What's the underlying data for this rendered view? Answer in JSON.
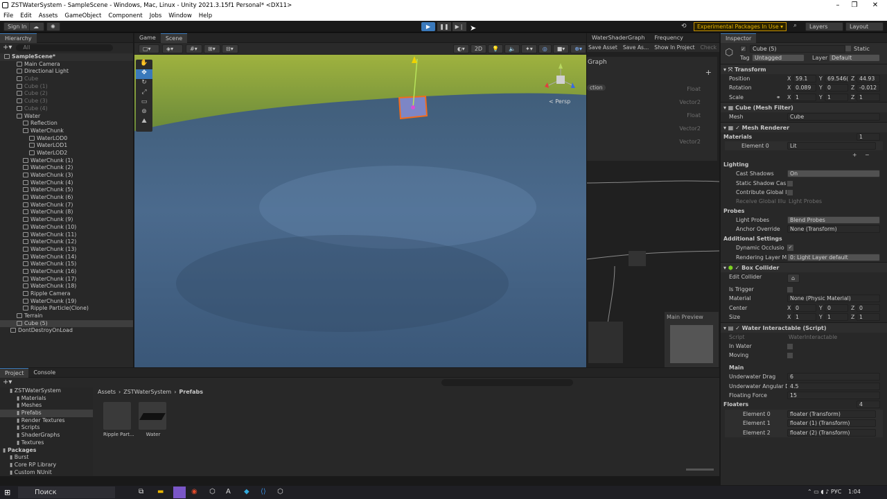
{
  "window": {
    "title": "ZSTWaterSystem - SampleScene - Windows, Mac, Linux - Unity 2021.3.15f1 Personal* <DX11>"
  },
  "menu": [
    "File",
    "Edit",
    "Assets",
    "GameObject",
    "Component",
    "Jobs",
    "Window",
    "Help"
  ],
  "toolbar": {
    "signin": "Sign In",
    "experimental": "Experimental Packages In Use ▾",
    "layers": "Layers",
    "layout": "Layout"
  },
  "hierarchy": {
    "tab": "Hierarchy",
    "search": "All",
    "items": [
      {
        "label": "SampleScene*",
        "indent": 0,
        "dim": false
      },
      {
        "label": "Main Camera",
        "indent": 2,
        "dim": false
      },
      {
        "label": "Directional Light",
        "indent": 2,
        "dim": false
      },
      {
        "label": "Cube",
        "indent": 2,
        "dim": true
      },
      {
        "label": "Cube (1)",
        "indent": 2,
        "dim": true
      },
      {
        "label": "Cube (2)",
        "indent": 2,
        "dim": true
      },
      {
        "label": "Cube (3)",
        "indent": 2,
        "dim": true
      },
      {
        "label": "Cube (4)",
        "indent": 2,
        "dim": true
      },
      {
        "label": "Water",
        "indent": 2,
        "dim": false
      },
      {
        "label": "Reflection",
        "indent": 3,
        "dim": false
      },
      {
        "label": "WaterChunk",
        "indent": 3,
        "dim": false
      },
      {
        "label": "WaterLOD0",
        "indent": 4,
        "dim": false
      },
      {
        "label": "WaterLOD1",
        "indent": 4,
        "dim": false
      },
      {
        "label": "WaterLOD2",
        "indent": 4,
        "dim": false
      },
      {
        "label": "WaterChunk (1)",
        "indent": 3,
        "dim": false
      },
      {
        "label": "WaterChunk (2)",
        "indent": 3,
        "dim": false
      },
      {
        "label": "WaterChunk (3)",
        "indent": 3,
        "dim": false
      },
      {
        "label": "WaterChunk (4)",
        "indent": 3,
        "dim": false
      },
      {
        "label": "WaterChunk (5)",
        "indent": 3,
        "dim": false
      },
      {
        "label": "WaterChunk (6)",
        "indent": 3,
        "dim": false
      },
      {
        "label": "WaterChunk (7)",
        "indent": 3,
        "dim": false
      },
      {
        "label": "WaterChunk (8)",
        "indent": 3,
        "dim": false
      },
      {
        "label": "WaterChunk (9)",
        "indent": 3,
        "dim": false
      },
      {
        "label": "WaterChunk (10)",
        "indent": 3,
        "dim": false
      },
      {
        "label": "WaterChunk (11)",
        "indent": 3,
        "dim": false
      },
      {
        "label": "WaterChunk (12)",
        "indent": 3,
        "dim": false
      },
      {
        "label": "WaterChunk (13)",
        "indent": 3,
        "dim": false
      },
      {
        "label": "WaterChunk (14)",
        "indent": 3,
        "dim": false
      },
      {
        "label": "WaterChunk (15)",
        "indent": 3,
        "dim": false
      },
      {
        "label": "WaterChunk (16)",
        "indent": 3,
        "dim": false
      },
      {
        "label": "WaterChunk (17)",
        "indent": 3,
        "dim": false
      },
      {
        "label": "WaterChunk (18)",
        "indent": 3,
        "dim": false
      },
      {
        "label": "Ripple Camera",
        "indent": 3,
        "dim": false
      },
      {
        "label": "WaterChunk (19)",
        "indent": 3,
        "dim": false
      },
      {
        "label": "Ripple Particle(Clone)",
        "indent": 3,
        "dim": false
      },
      {
        "label": "Terrain",
        "indent": 2,
        "dim": false
      },
      {
        "label": "Cube (5)",
        "indent": 2,
        "dim": false,
        "selected": true
      },
      {
        "label": "DontDestroyOnLoad",
        "indent": 1,
        "dim": false
      }
    ]
  },
  "scene": {
    "tabs": [
      "Game",
      "Scene"
    ],
    "active": "Scene",
    "persp": "< Persp",
    "gizmo_value": "2D"
  },
  "shadergraph": {
    "tabs": [
      "WaterShaderGraph",
      "Frequency"
    ],
    "save_asset": "Save Asset",
    "save_as": "Save As...",
    "show_in_project": "Show In Project",
    "check": "Check",
    "graph_label": "Graph",
    "section": "ction",
    "ports": [
      "Float",
      "Vector2",
      "Float",
      "Vector2",
      "Vector2"
    ],
    "main_preview": "Main Preview"
  },
  "inspector": {
    "tab": "Inspector",
    "object_name": "Cube (5)",
    "static": "Static",
    "tag_label": "Tag",
    "tag": "Untagged",
    "layer_label": "Layer",
    "layer": "Default",
    "transform": {
      "title": "Transform",
      "position": [
        "59.1",
        "69.546(",
        "44.93"
      ],
      "rotation": [
        "0.089",
        "0",
        "-0.012"
      ],
      "scale": [
        "1",
        "1",
        "1"
      ]
    },
    "mesh_filter": {
      "title": "Cube (Mesh Filter)",
      "mesh_label": "Mesh",
      "mesh": "Cube"
    },
    "mesh_renderer": {
      "title": "Mesh Renderer",
      "materials": "Materials",
      "materials_count": "1",
      "element0": "Element 0",
      "lit": "Lit",
      "lighting": "Lighting",
      "cast_shadows_label": "Cast Shadows",
      "cast_shadows": "On",
      "static_shadow": "Static Shadow Cas",
      "contribute_gi": "Contribute Global Il",
      "receive_gi": "Receive Global Illu",
      "light_probes_dis": "Light Probes",
      "probes": "Probes",
      "light_probes_label": "Light Probes",
      "light_probes": "Blend Probes",
      "anchor_label": "Anchor Override",
      "anchor": "None (Transform)",
      "additional": "Additional Settings",
      "dynamic_occ": "Dynamic Occlusio",
      "rendering_layer_label": "Rendering Layer M",
      "rendering_layer": "0: Light Layer default"
    },
    "box_collider": {
      "title": "Box Collider",
      "edit_collider": "Edit Collider",
      "is_trigger": "Is Trigger",
      "material_label": "Material",
      "material": "None (Physic Material)",
      "center_label": "Center",
      "center": [
        "0",
        "0",
        "0"
      ],
      "size_label": "Size",
      "size": [
        "1",
        "1",
        "1"
      ]
    },
    "water_interactable": {
      "title": "Water Interactable (Script)",
      "script_label": "Script",
      "script": "WaterInteractable",
      "in_water": "In Water",
      "moving": "Moving",
      "main": "Main",
      "underwater_drag_label": "Underwater Drag",
      "underwater_drag": "6",
      "underwater_ang_label": "Underwater Angular D",
      "underwater_ang": "4.5",
      "floating_force_label": "Floating Force",
      "floating_force": "15",
      "floaters_label": "Floaters",
      "floaters_count": "4",
      "floaters": [
        {
          "label": "Element 0",
          "value": "floater (Transform)"
        },
        {
          "label": "Element 1",
          "value": "floater (1) (Transform)"
        },
        {
          "label": "Element 2",
          "value": "floater (2) (Transform)"
        }
      ]
    }
  },
  "project": {
    "tabs": [
      "Project",
      "Console"
    ],
    "tree": [
      {
        "label": "ZSTWaterSystem",
        "indent": 1
      },
      {
        "label": "Materials",
        "indent": 2
      },
      {
        "label": "Meshes",
        "indent": 2
      },
      {
        "label": "Prefabs",
        "indent": 2,
        "selected": true
      },
      {
        "label": "Render Textures",
        "indent": 2
      },
      {
        "label": "Scripts",
        "indent": 2
      },
      {
        "label": "ShaderGraphs",
        "indent": 2
      },
      {
        "label": "Textures",
        "indent": 2
      },
      {
        "label": "Packages",
        "indent": 0,
        "bold": true
      },
      {
        "label": "Burst",
        "indent": 1
      },
      {
        "label": "Core RP Library",
        "indent": 1
      },
      {
        "label": "Custom NUnit",
        "indent": 1
      }
    ],
    "breadcrumb": [
      "Assets",
      "ZSTWaterSystem",
      "Prefabs"
    ],
    "assets": [
      {
        "label": "Ripple Part..."
      },
      {
        "label": "Water"
      }
    ]
  },
  "taskbar": {
    "search": "Поиск",
    "lang": "РУС",
    "time": "1:04"
  }
}
